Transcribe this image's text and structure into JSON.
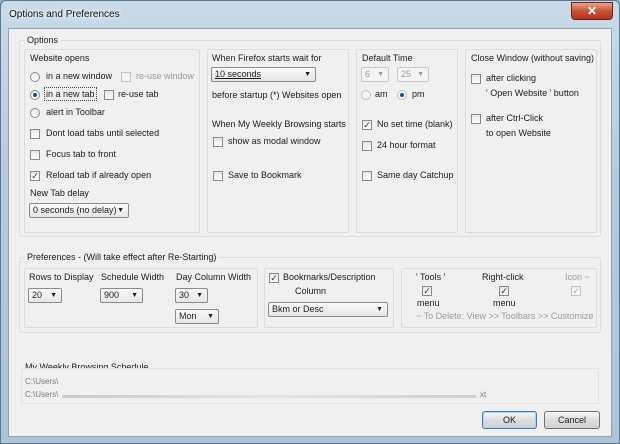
{
  "window": {
    "title": "Options and Preferences",
    "close_glyph": "✕"
  },
  "options": {
    "legend": "Options",
    "website_opens": {
      "title": "Website opens",
      "radio_new_window": "in a new window",
      "reuse_window": "re-use window",
      "radio_new_tab": "in a new tab",
      "reuse_tab": "re-use tab",
      "radio_alert": "alert in Toolbar",
      "dont_load": "Dont load tabs until selected",
      "focus_tab": "Focus tab to front",
      "reload_tab": "Reload tab if already open",
      "new_tab_delay_label": "New Tab delay",
      "new_tab_delay_value": "0 seconds (no delay)"
    },
    "firefox_start": {
      "title": "When Firefox starts wait for",
      "wait_value": "10 seconds",
      "before_startup": "before startup (*) Websites open",
      "weekly_title": "When My Weekly Browsing starts",
      "show_modal": "show as modal window",
      "save_bookmark": "Save to Bookmark"
    },
    "default_time": {
      "title": "Default Time",
      "hour": "6",
      "minute": "25",
      "am": "am",
      "pm": "pm",
      "no_set_time": "No set time (blank)",
      "hour24": "24 hour format",
      "same_day": "Same day Catchup"
    },
    "close_window": {
      "title": "Close Window (without saving)",
      "after_clicking": "after clicking",
      "open_website": "' Open Website ' button",
      "after_ctrl": "after Ctrl-Click",
      "to_open": "to open Website"
    }
  },
  "preferences": {
    "legend": "Preferences - (Will take effect after Re-Starting)",
    "rows_label": "Rows to Display",
    "rows_value": "20",
    "schedule_label": "Schedule Width",
    "schedule_value": "900",
    "day_col_label": "Day Column Width",
    "day_col_value": "30",
    "day_value": "Mon",
    "bookmarks_label": "Bookmarks/Description",
    "column_label": "Column",
    "column_value": "Bkm or Desc",
    "tools_label": "' Tools '",
    "rightclick_label": "Right-click",
    "icon_label": "Icon ~",
    "menu1": "menu",
    "menu2": "menu",
    "delete_hint": "~ To Delete: View >> Toolbars >> Customize"
  },
  "schedule": {
    "legend": "My Weekly Browsing Schedule",
    "path1": "C:\\Users\\",
    "path2": "C:\\Users\\",
    "path2_end": "xt"
  },
  "buttons": {
    "ok": "OK",
    "cancel": "Cancel"
  },
  "glyphs": {
    "check": "✓",
    "dropdown": "▼"
  }
}
